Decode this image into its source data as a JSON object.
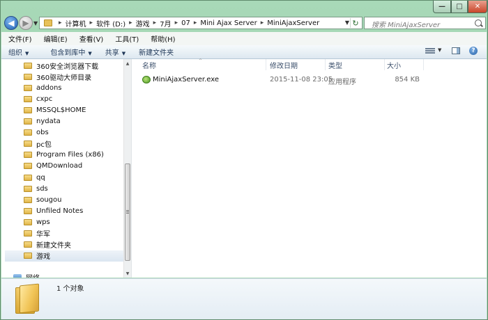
{
  "window": {
    "controls": {
      "minimize": "—",
      "maximize": "□",
      "close": "✕"
    }
  },
  "nav": {
    "back_glyph": "◀",
    "forward_glyph": "▶",
    "breadcrumbs": [
      "计算机",
      "软件 (D:)",
      "游戏",
      "7月",
      "07",
      "Mini Ajax Server",
      "MiniAjaxServer"
    ],
    "search_placeholder": "搜索 MiniAjaxServer"
  },
  "menubar": {
    "items": [
      "文件(F)",
      "编辑(E)",
      "查看(V)",
      "工具(T)",
      "帮助(H)"
    ]
  },
  "toolbar": {
    "organize": "组织",
    "include_in_library": "包含到库中",
    "share": "共享",
    "new_folder": "新建文件夹",
    "help_glyph": "?"
  },
  "tree": {
    "items": [
      "360安全浏览器下载",
      "360驱动大师目录",
      "addons",
      "cxpc",
      "MSSQL$HOME",
      "nydata",
      "obs",
      "pc包",
      "Program Files (x86)",
      "QMDownload",
      "qq",
      "sds",
      "sougou",
      "Unfiled Notes",
      "wps",
      "华军",
      "新建文件夹",
      "游戏"
    ],
    "selected_index": 17,
    "network": "网络"
  },
  "columns": {
    "name": "名称",
    "date": "修改日期",
    "type": "类型",
    "size": "大小"
  },
  "files": [
    {
      "name": "MiniAjaxServer.exe",
      "date": "2015-11-08 23:05",
      "type": "应用程序",
      "size": "854 KB"
    }
  ],
  "details": {
    "item_count": "1 个对象"
  }
}
